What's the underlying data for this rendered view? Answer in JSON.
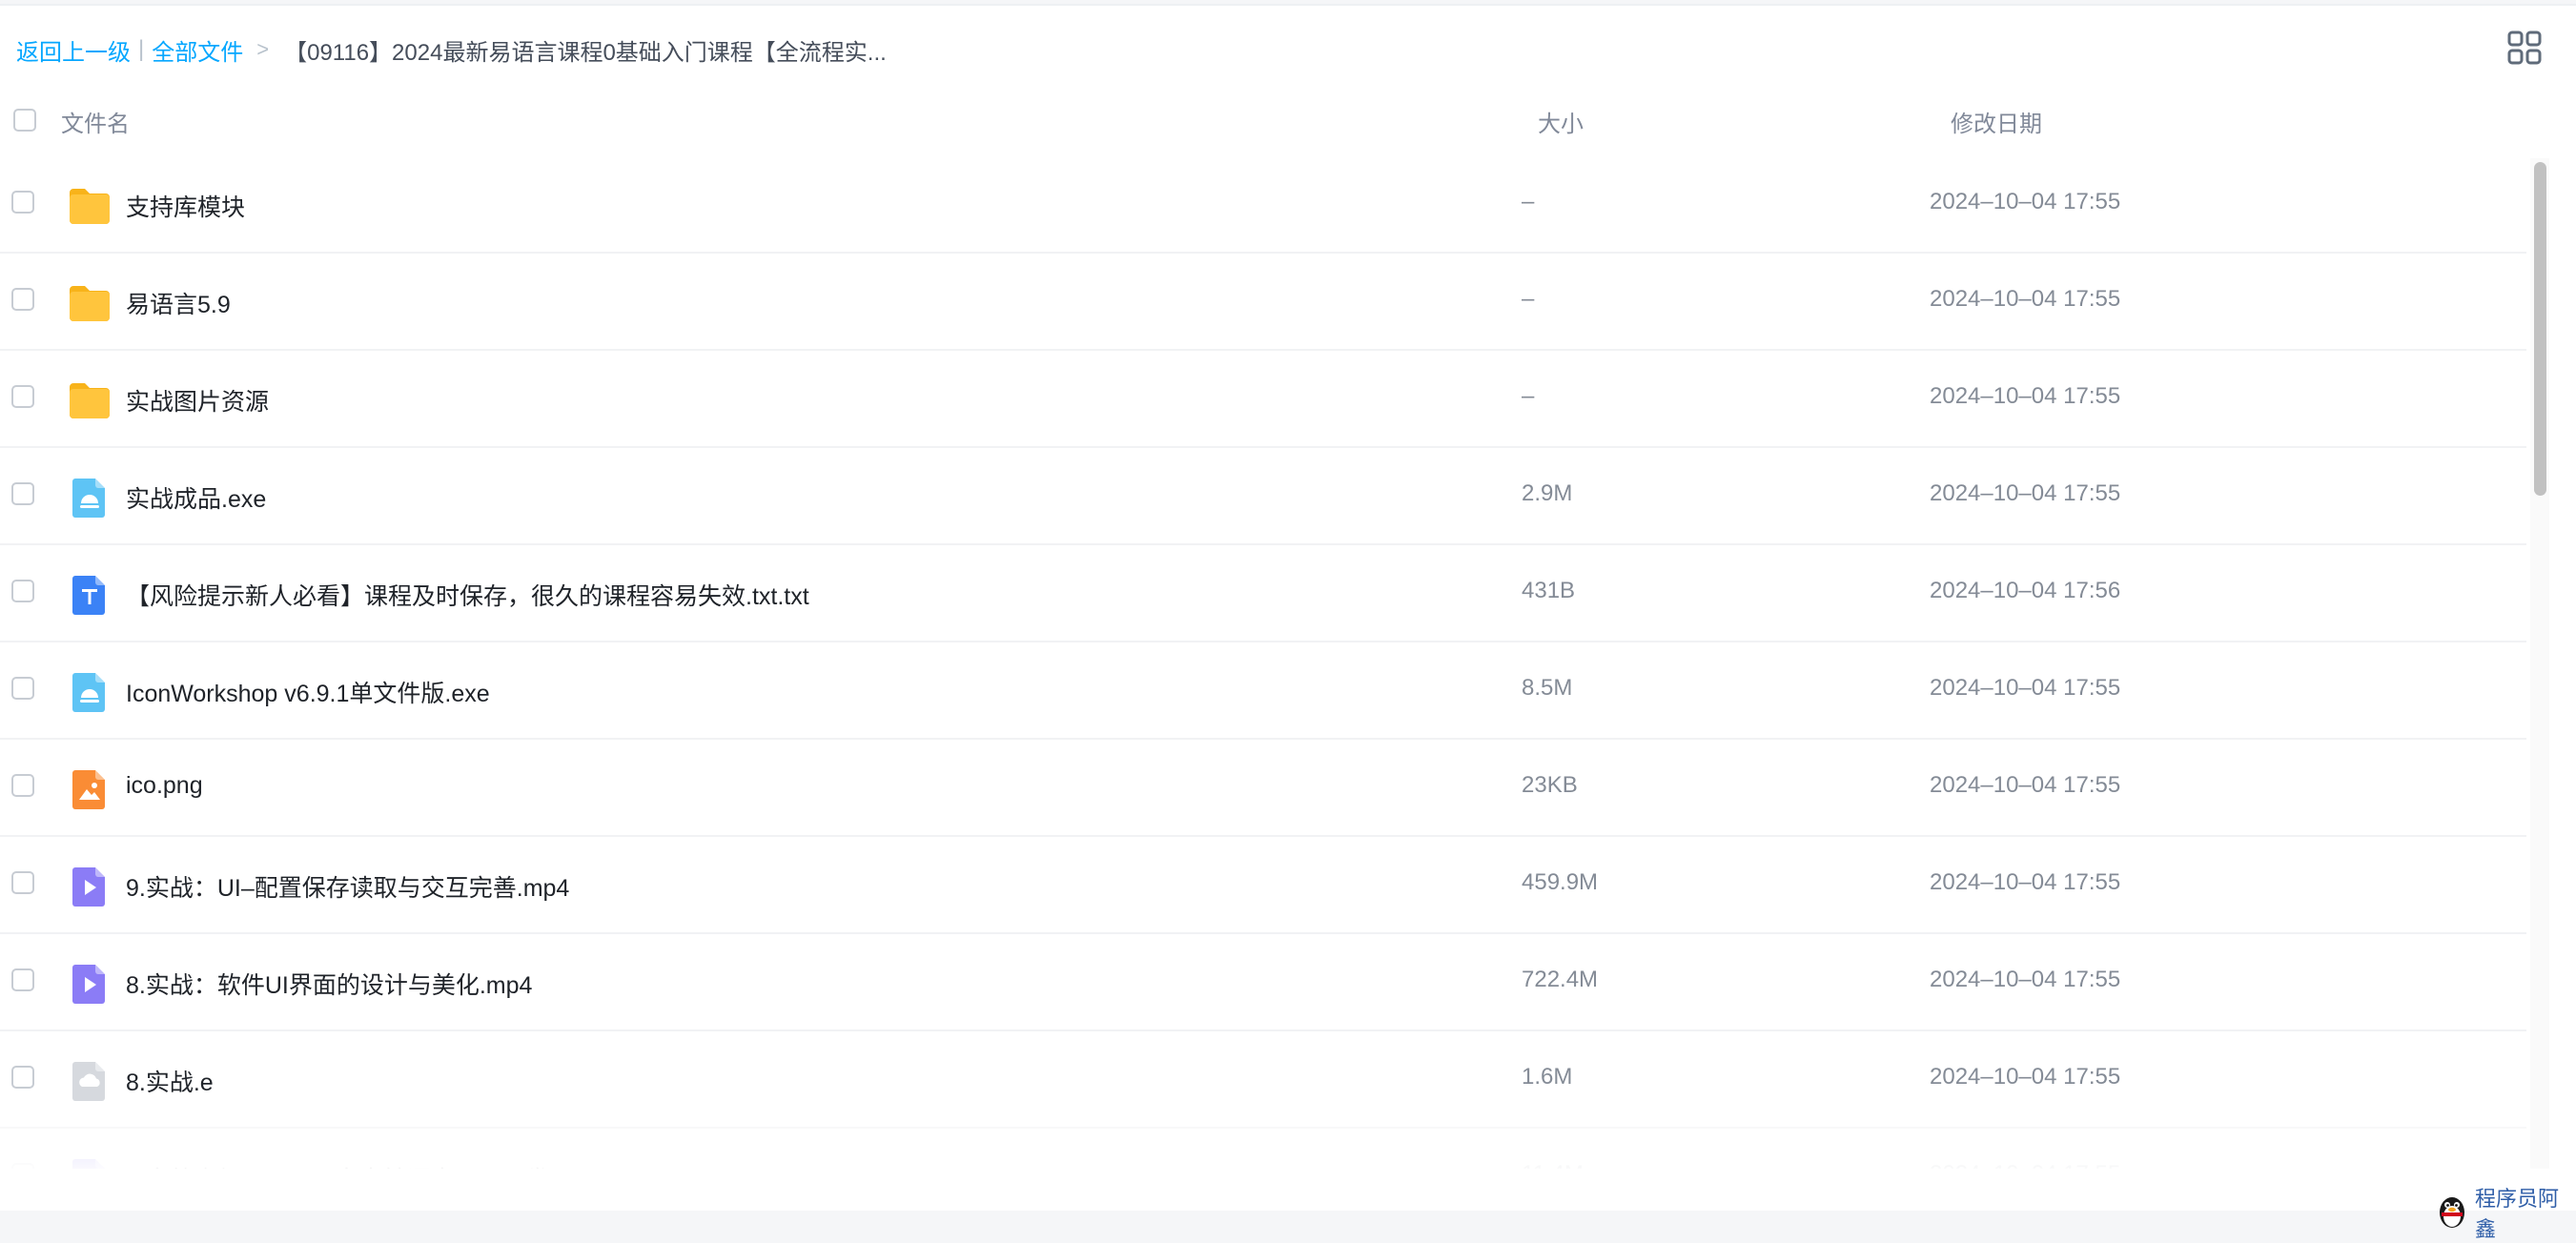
{
  "breadcrumb": {
    "back": "返回上一级",
    "separator": "|",
    "all_files": "全部文件",
    "arrow": ">",
    "current": "【09116】2024最新易语言课程0基础入门课程【全流程实..."
  },
  "table": {
    "col_name": "文件名",
    "col_size": "大小",
    "col_date": "修改日期"
  },
  "files": [
    {
      "name": "支持库模块",
      "size": "–",
      "date": "2024–10–04 17:55",
      "icon": "folder-icon"
    },
    {
      "name": "易语言5.9",
      "size": "–",
      "date": "2024–10–04 17:55",
      "icon": "folder-icon"
    },
    {
      "name": "实战图片资源",
      "size": "–",
      "date": "2024–10–04 17:55",
      "icon": "folder-icon"
    },
    {
      "name": "实战成品.exe",
      "size": "2.9M",
      "date": "2024–10–04 17:55",
      "icon": "exe-file-icon"
    },
    {
      "name": "【风险提示新人必看】课程及时保存，很久的课程容易失效.txt.txt",
      "size": "431B",
      "date": "2024–10–04 17:56",
      "icon": "txt-file-icon"
    },
    {
      "name": "IconWorkshop v6.9.1单文件版.exe",
      "size": "8.5M",
      "date": "2024–10–04 17:55",
      "icon": "exe-file-icon"
    },
    {
      "name": "ico.png",
      "size": "23KB",
      "date": "2024–10–04 17:55",
      "icon": "image-file-icon"
    },
    {
      "name": "9.实战：UI–配置保存读取与交互完善.mp4",
      "size": "459.9M",
      "date": "2024–10–04 17:55",
      "icon": "video-file-icon"
    },
    {
      "name": "8.实战：软件UI界面的设计与美化.mp4",
      "size": "722.4M",
      "date": "2024–10–04 17:55",
      "icon": "video-file-icon"
    },
    {
      "name": "8.实战.e",
      "size": "1.6M",
      "date": "2024–10–04 17:55",
      "icon": "unknown-file-icon"
    },
    {
      "name": "7.实战介绍：Groovi文本转语音工具开发.mp4",
      "size": "11.4M",
      "date": "2024–10–04 17:55",
      "icon": "video-file-icon"
    }
  ],
  "watermark": {
    "text": "程序员阿鑫",
    "icon": "penguin-icon"
  },
  "colors": {
    "link": "#06a7ff",
    "folder": "#ffc53d",
    "exe": "#5ec4f5",
    "txt": "#3b82f6",
    "image": "#fa8c35",
    "video": "#8b7cf6",
    "unknown": "#d6d9de"
  }
}
